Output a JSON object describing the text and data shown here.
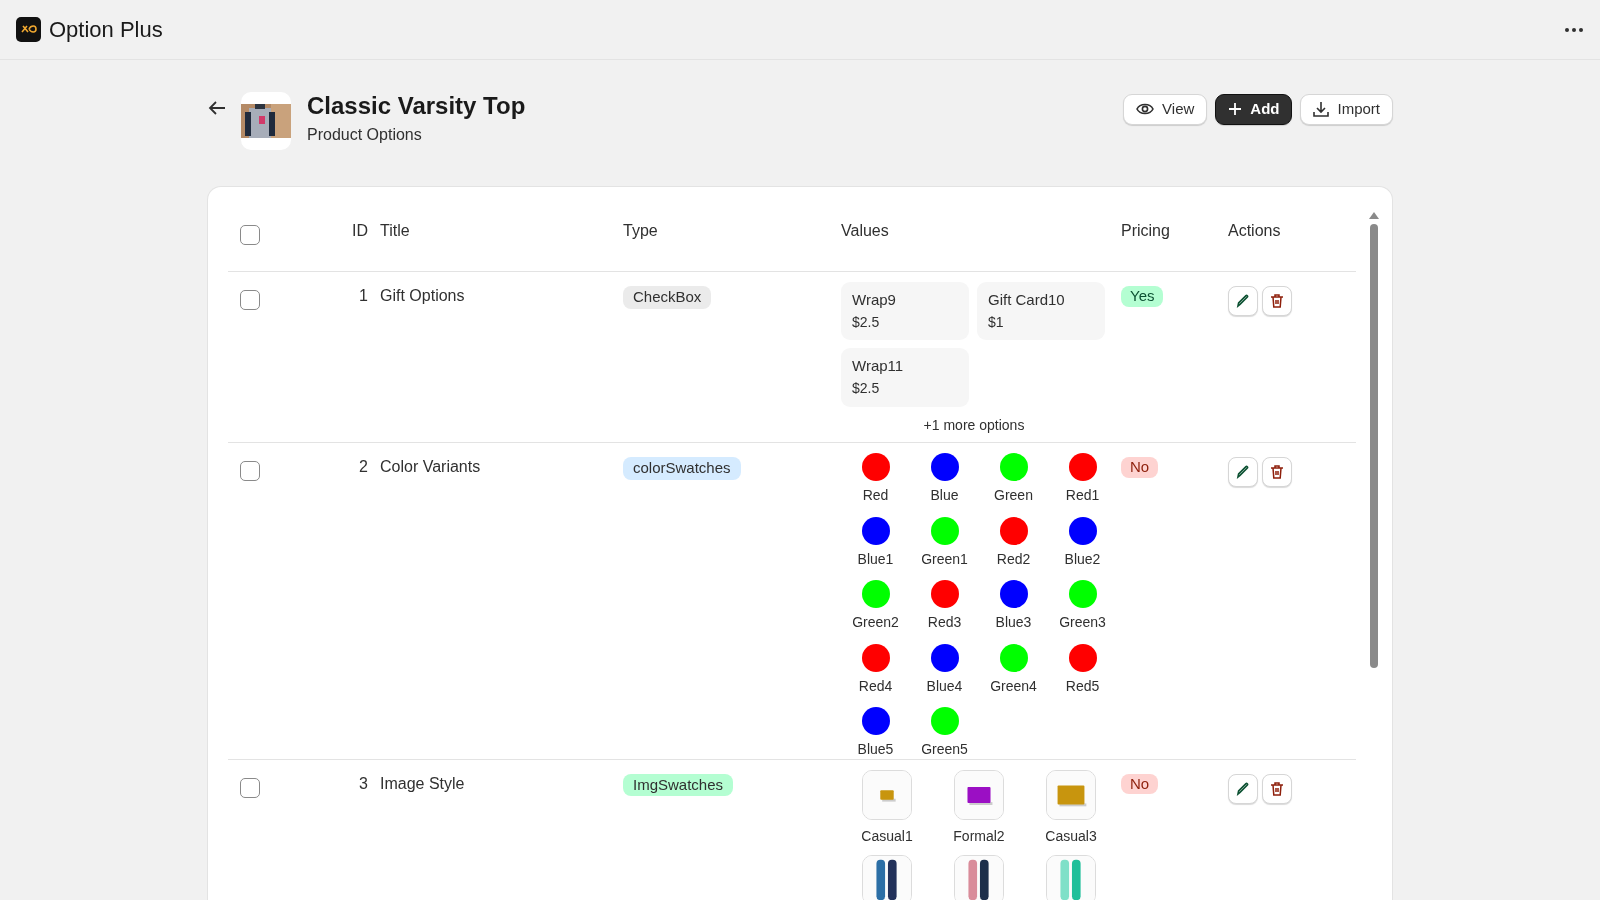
{
  "app": {
    "name": "Option Plus"
  },
  "product": {
    "title": "Classic Varsity Top",
    "subtitle": "Product Options"
  },
  "buttons": [
    {
      "label": "View",
      "kind": "view"
    },
    {
      "label": "Add",
      "kind": "add"
    },
    {
      "label": "Import",
      "kind": "import"
    }
  ],
  "table": {
    "select_all": {
      "checked": false
    },
    "columns": [
      "ID",
      "Title",
      "Type",
      "Values",
      "Pricing",
      "Actions"
    ],
    "rows": [
      {
        "checked": false,
        "id": "1",
        "title": "Gift Options",
        "type": "CheckBox",
        "kind": "price",
        "values": [
          {
            "label": "Wrap9",
            "price": "$2.5"
          },
          {
            "label": "Gift Card10",
            "price": "$1"
          },
          {
            "label": "Wrap11",
            "price": "$2.5"
          }
        ],
        "more": "+1 more options",
        "pricing": {
          "label": "Yes",
          "on": true
        }
      },
      {
        "checked": false,
        "id": "2",
        "title": "Color Variants",
        "type": "colorSwatches",
        "kind": "color",
        "values": [
          {
            "label": "Red",
            "color": "#ff0000"
          },
          {
            "label": "Blue",
            "color": "#0000ff"
          },
          {
            "label": "Green",
            "color": "#00ff00"
          },
          {
            "label": "Red1",
            "color": "#ff0000"
          },
          {
            "label": "Blue1",
            "color": "#0000ff"
          },
          {
            "label": "Green1",
            "color": "#00ff00"
          },
          {
            "label": "Red2",
            "color": "#ff0000"
          },
          {
            "label": "Blue2",
            "color": "#0000ff"
          },
          {
            "label": "Green2",
            "color": "#00ff00"
          },
          {
            "label": "Red3",
            "color": "#ff0000"
          },
          {
            "label": "Blue3",
            "color": "#0000ff"
          },
          {
            "label": "Green3",
            "color": "#00ff00"
          },
          {
            "label": "Red4",
            "color": "#ff0000"
          },
          {
            "label": "Blue4",
            "color": "#0000ff"
          },
          {
            "label": "Green4",
            "color": "#00ff00"
          },
          {
            "label": "Red5",
            "color": "#ff0000"
          },
          {
            "label": "Blue5",
            "color": "#0000ff"
          },
          {
            "label": "Green5",
            "color": "#00ff00"
          }
        ],
        "pricing": {
          "label": "No",
          "on": false
        }
      },
      {
        "checked": false,
        "id": "3",
        "title": "Image Style",
        "type": "ImgSwatches",
        "values": [
          {
            "label": "Casual1",
            "kind": "picture"
          },
          {
            "label": "Formal2",
            "kind": "picture"
          },
          {
            "label": "Casual3",
            "kind": "picture"
          },
          {
            "kind": "picture"
          },
          {
            "kind": "picture"
          },
          {
            "kind": "picture"
          }
        ],
        "pricing": {
          "label": "No",
          "on": false
        }
      }
    ]
  }
}
